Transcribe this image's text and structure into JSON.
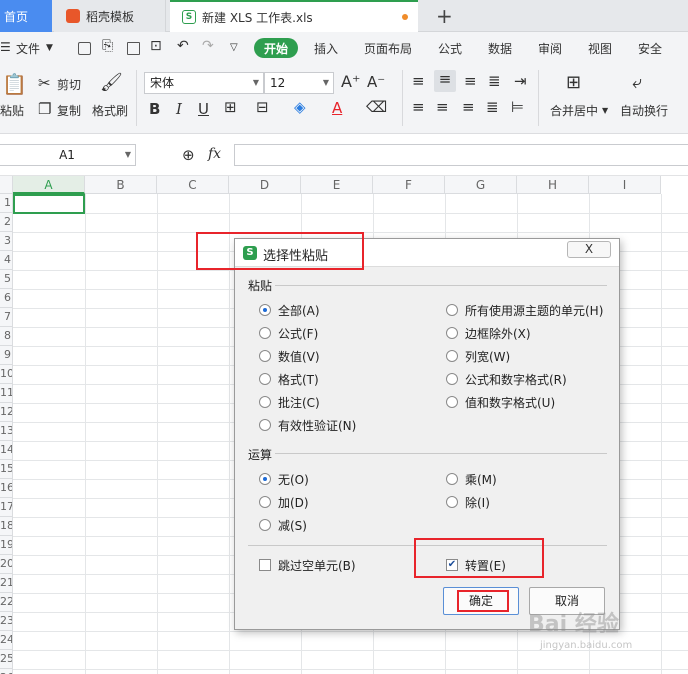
{
  "tabs": {
    "home": "首页",
    "template": "稻壳模板",
    "file": "新建 XLS 工作表.xls",
    "plus": "+"
  },
  "menu": {
    "file": "文件",
    "start": "开始",
    "insert": "插入",
    "layout": "页面布局",
    "formula": "公式",
    "data": "数据",
    "review": "审阅",
    "view": "视图",
    "security": "安全"
  },
  "ribbon": {
    "paste": "粘贴",
    "cut": "剪切",
    "copy": "复制",
    "format_painter": "格式刷",
    "font_name": "宋体",
    "font_size": "12",
    "merge_center": "合并居中",
    "wrap_text": "自动换行"
  },
  "formula_bar": {
    "cell_ref": "A1",
    "fx": "fx"
  },
  "grid": {
    "columns": [
      "A",
      "B",
      "C",
      "D",
      "E",
      "F",
      "G",
      "H",
      "I"
    ],
    "rows": [
      "1",
      "2",
      "3",
      "4",
      "5",
      "6",
      "7",
      "8",
      "9",
      "10",
      "11",
      "12",
      "13",
      "14",
      "15",
      "16",
      "17",
      "18",
      "19",
      "20",
      "21",
      "22",
      "23",
      "24",
      "25",
      "26"
    ]
  },
  "dialog": {
    "title": "选择性粘贴",
    "close": "X",
    "paste_group": "粘贴",
    "paste_options_left": [
      "全部(A)",
      "公式(F)",
      "数值(V)",
      "格式(T)",
      "批注(C)",
      "有效性验证(N)"
    ],
    "paste_options_right": [
      "所有使用源主题的单元(H)",
      "边框除外(X)",
      "列宽(W)",
      "公式和数字格式(R)",
      "值和数字格式(U)"
    ],
    "op_group": "运算",
    "op_options_left": [
      "无(O)",
      "加(D)",
      "减(S)"
    ],
    "op_options_right": [
      "乘(M)",
      "除(I)"
    ],
    "skip_blanks": "跳过空单元(B)",
    "transpose": "转置(E)",
    "ok": "确定",
    "cancel": "取消"
  },
  "watermark": {
    "text": "Bai 经验",
    "sub": "jingyan.baidu.com"
  }
}
